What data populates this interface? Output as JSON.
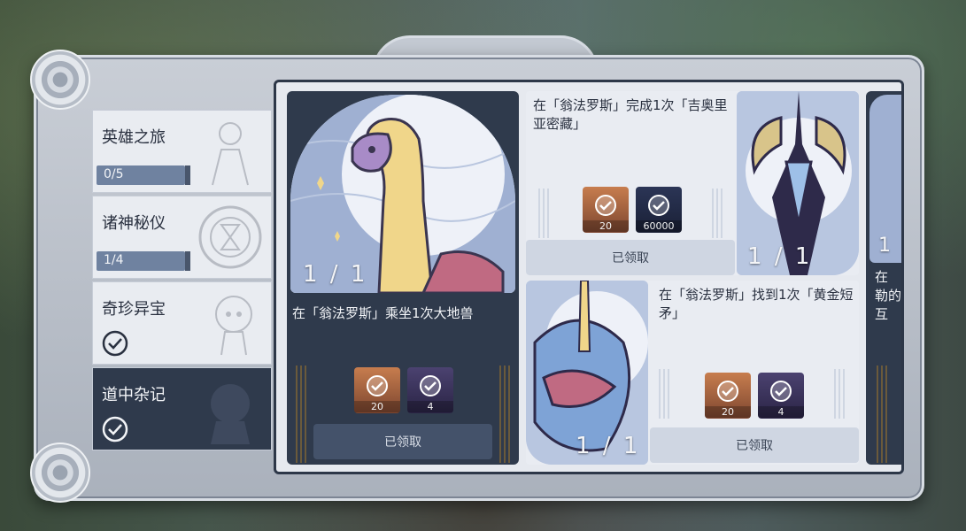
{
  "sidebar": {
    "items": [
      {
        "label": "英雄之旅",
        "progress": "0/5"
      },
      {
        "label": "诸神秘仪",
        "progress": "1/4"
      },
      {
        "label": "奇珍异宝"
      },
      {
        "label": "道中杂记"
      }
    ]
  },
  "cards": {
    "big": {
      "count": "1 / 1",
      "description": "在「翁法罗斯」乘坐1次大地兽",
      "rewards": [
        "20",
        "4"
      ],
      "status": "已领取"
    },
    "top": {
      "description": "在「翁法罗斯」完成1次「吉奥里亚密藏」",
      "count": "1 / 1",
      "rewards": [
        "20",
        "60000"
      ],
      "status": "已领取"
    },
    "bottom": {
      "description": "在「翁法罗斯」找到1次「黄金短矛」",
      "count": "1 / 1",
      "rewards": [
        "20",
        "4"
      ],
      "status": "已领取"
    },
    "partial": {
      "count": "1",
      "lines": [
        "在",
        "勒的",
        "互"
      ]
    }
  },
  "colors": {
    "panel_dark": "#2f3a4c",
    "panel_light": "#e6e9ef",
    "reward_gold": "#c77d4e",
    "reward_purple": "#4b4270"
  }
}
